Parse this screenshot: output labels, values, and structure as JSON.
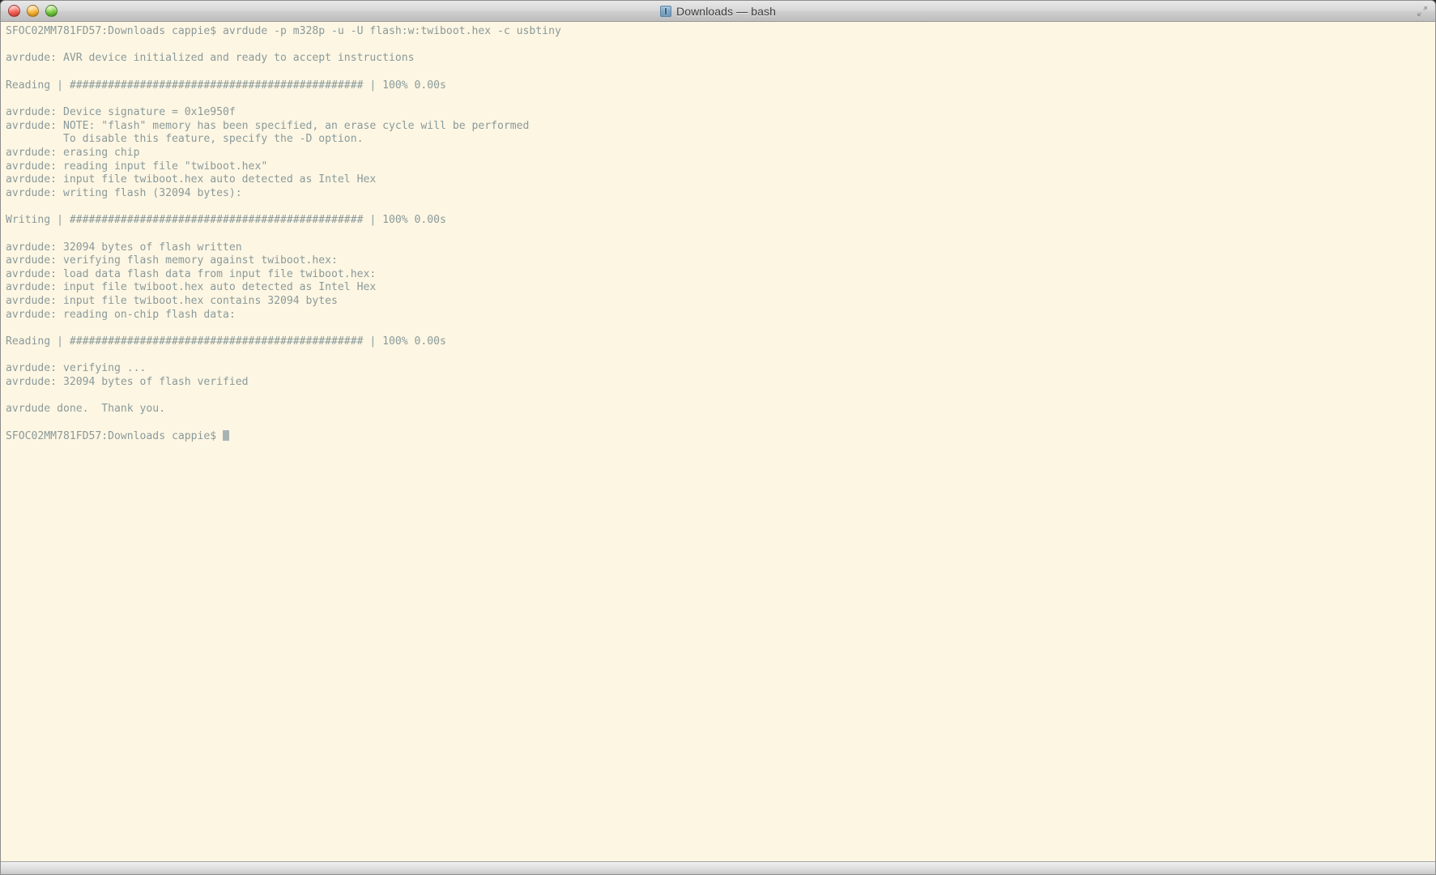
{
  "window": {
    "title": "Downloads — bash",
    "title_icon": "downloads-folder-icon",
    "controls": {
      "close_label": "close",
      "minimize_label": "minimize",
      "zoom_label": "zoom"
    },
    "fullscreen_icon": "fullscreen-arrows-icon",
    "background_color": "#fdf6e3",
    "text_color": "#8a9a9a",
    "titlebar_text_color": "#3c3c3c"
  },
  "terminal": {
    "prompt": "SFOC02MM781FD57:Downloads cappie$",
    "command": "avrdude -p m328p -u -U flash:w:twiboot.hex -c usbtiny",
    "progress_bar_hashes": "##############################################",
    "cursor_visible": true,
    "lines": [
      "SFOC02MM781FD57:Downloads cappie$ avrdude -p m328p -u -U flash:w:twiboot.hex -c usbtiny",
      "",
      "avrdude: AVR device initialized and ready to accept instructions",
      "",
      "Reading | ############################################## | 100% 0.00s",
      "",
      "avrdude: Device signature = 0x1e950f",
      "avrdude: NOTE: \"flash\" memory has been specified, an erase cycle will be performed",
      "         To disable this feature, specify the -D option.",
      "avrdude: erasing chip",
      "avrdude: reading input file \"twiboot.hex\"",
      "avrdude: input file twiboot.hex auto detected as Intel Hex",
      "avrdude: writing flash (32094 bytes):",
      "",
      "Writing | ############################################## | 100% 0.00s",
      "",
      "avrdude: 32094 bytes of flash written",
      "avrdude: verifying flash memory against twiboot.hex:",
      "avrdude: load data flash data from input file twiboot.hex:",
      "avrdude: input file twiboot.hex auto detected as Intel Hex",
      "avrdude: input file twiboot.hex contains 32094 bytes",
      "avrdude: reading on-chip flash data:",
      "",
      "Reading | ############################################## | 100% 0.00s",
      "",
      "avrdude: verifying ...",
      "avrdude: 32094 bytes of flash verified",
      "",
      "avrdude done.  Thank you.",
      "",
      "SFOC02MM781FD57:Downloads cappie$ "
    ]
  }
}
